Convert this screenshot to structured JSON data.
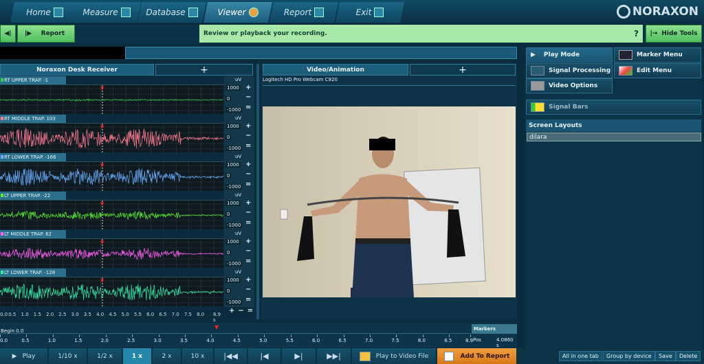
{
  "nav": {
    "tabs": [
      {
        "label": "Home"
      },
      {
        "label": "Measure"
      },
      {
        "label": "Database"
      },
      {
        "label": "Viewer",
        "active": true
      },
      {
        "label": "Report"
      },
      {
        "label": "Exit"
      }
    ],
    "logo": "NORAXON"
  },
  "toolbar": {
    "report": "Report",
    "message": "Review or playback your recording.",
    "help": "?",
    "hide_tools": "Hide Tools"
  },
  "emg": {
    "title": "Noraxon Desk Receiver",
    "add": "+",
    "unit": "uV",
    "max": "1000",
    "zero": "0",
    "min": "-1000",
    "channels": [
      {
        "label": "RT UPPER TRAP. -1",
        "color": "#33d14a",
        "amp": 0.05
      },
      {
        "label": "RT MIDDLE TRAP. 103",
        "color": "#ff7a90",
        "amp": 0.8
      },
      {
        "label": "RT LOWER TRAP. -166",
        "color": "#6aaeff",
        "amp": 0.7
      },
      {
        "label": "LT UPPER TRAP. -22",
        "color": "#5cf02e",
        "amp": 0.35
      },
      {
        "label": "LT MIDDLE TRAP. 62",
        "color": "#ff5ef0",
        "amp": 0.45
      },
      {
        "label": "LT LOWER TRAP. -128",
        "color": "#33f0a8",
        "amp": 0.7
      }
    ],
    "time_ticks": [
      "0.0",
      "0.5",
      "1.0",
      "1.5",
      "2.0",
      "2.5",
      "3.0",
      "3.5",
      "4.0",
      "4.5",
      "5.0",
      "5.5",
      "6.0",
      "6.5",
      "7.0",
      "7.5",
      "8.0",
      "8.9 s"
    ],
    "cursor_time": 4.08
  },
  "video": {
    "title": "Video/Animation",
    "add": "+",
    "camera": "Logitech HD Pro Webcam C920"
  },
  "right": {
    "play_mode": "Play Mode",
    "marker_menu": "Marker Menu",
    "signal_processing": "Signal Processing",
    "edit_menu": "Edit Menu",
    "video_options": "Video Options",
    "signal_bars": "Signal Bars",
    "screen_layouts": "Screen Layouts",
    "layout_value": "dilara",
    "all_in_one_tab": "All in one tab",
    "group_by_device": "Group by device",
    "save": "Save",
    "delete": "Delete"
  },
  "timeline": {
    "begin": "Begin 0.0",
    "markers": "Markers",
    "pos_label": "Pos",
    "pos_value": "4.0860 s",
    "ticks": [
      "0.0",
      "0.5",
      "1.0",
      "1.5",
      "2.0",
      "2.5",
      "3.0",
      "3.5",
      "4.0",
      "4.5",
      "5.0",
      "5.5",
      "6.0",
      "6.5",
      "7.0",
      "7.5",
      "8.0",
      "8.5",
      "8.9"
    ]
  },
  "playback": {
    "play": "Play",
    "speeds": [
      "1/10 x",
      "1/2 x",
      "1 x",
      "2 x",
      "10 x"
    ],
    "selected_speed": "1 x",
    "play_to_video": "Play to Video File",
    "add_to_report": "Add To Report"
  }
}
